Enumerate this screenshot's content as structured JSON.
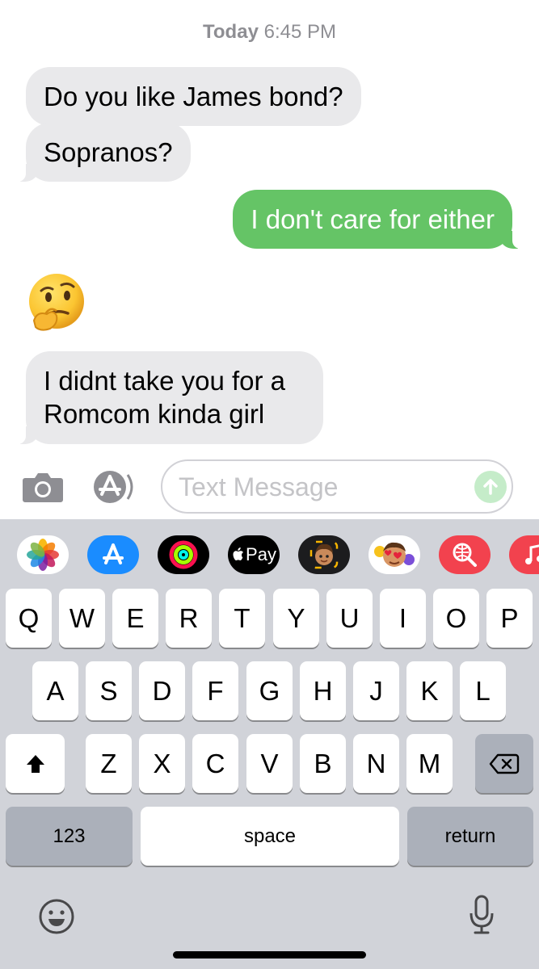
{
  "conversation": {
    "timestamp_day": "Today",
    "timestamp_time": "6:45 PM",
    "messages": [
      {
        "direction": "incoming",
        "text": "Do you like James bond?"
      },
      {
        "direction": "incoming",
        "text": "Sopranos?"
      },
      {
        "direction": "outgoing",
        "text": "I don't care for either"
      },
      {
        "direction": "incoming",
        "text": "🤔"
      },
      {
        "direction": "incoming",
        "text_line1": "I didnt take you for a",
        "text_line2": "Romcom kinda girl"
      }
    ]
  },
  "input_bar": {
    "camera_icon": "camera-icon",
    "apps_icon": "app-store-icon",
    "placeholder": "Text Message",
    "send_icon": "arrow-up-icon"
  },
  "app_strip": [
    "photos",
    "app-store",
    "activity",
    "apple-pay",
    "memoji-stickers",
    "animoji",
    "web-search",
    "music"
  ],
  "app_strip_labels": {
    "apple_pay": "Pay"
  },
  "keyboard": {
    "row1": [
      "Q",
      "W",
      "E",
      "R",
      "T",
      "Y",
      "U",
      "I",
      "O",
      "P"
    ],
    "row2": [
      "A",
      "S",
      "D",
      "F",
      "G",
      "H",
      "J",
      "K",
      "L"
    ],
    "row3": [
      "Z",
      "X",
      "C",
      "V",
      "B",
      "N",
      "M"
    ],
    "numbers_label": "123",
    "space_label": "space",
    "return_label": "return"
  },
  "colors": {
    "incoming_bubble": "#e9e9eb",
    "outgoing_bubble": "#65c466",
    "keyboard_bg": "#d1d3d9",
    "dark_key": "#abb0ba"
  }
}
